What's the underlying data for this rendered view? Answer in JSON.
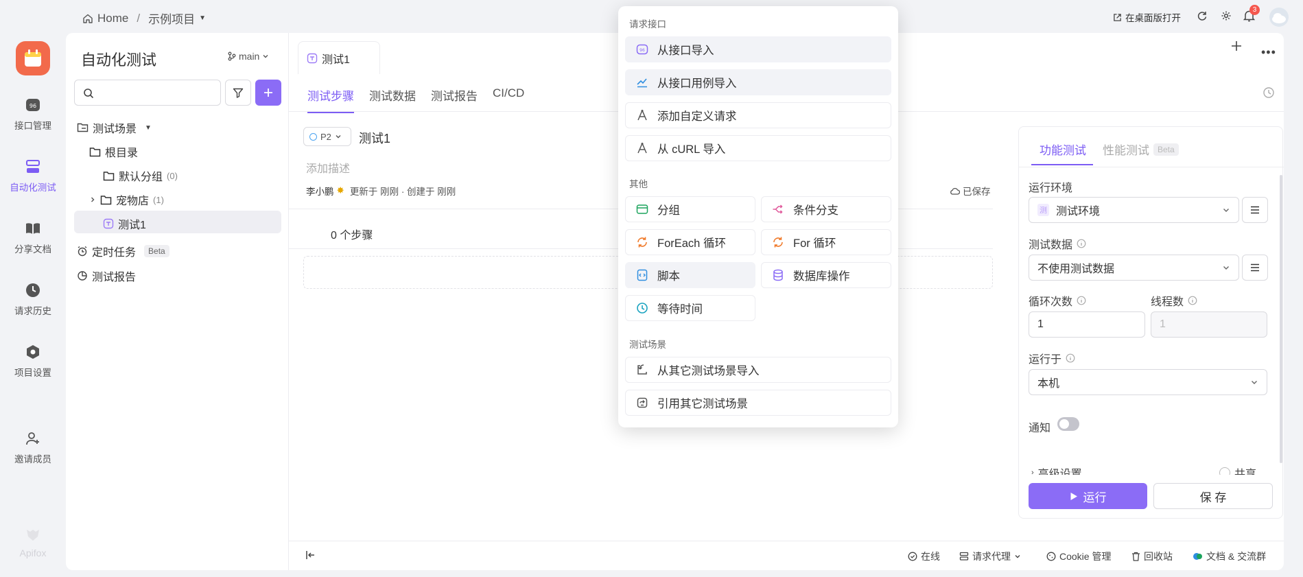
{
  "topbar": {
    "home": "Home",
    "separator": "/",
    "project": "示例项目",
    "open_desktop": "在桌面版打开",
    "notification_count": "3"
  },
  "rail": {
    "items": [
      {
        "label": "接口管理",
        "icon": "api-icon"
      },
      {
        "label": "自动化测试",
        "icon": "automation-icon"
      },
      {
        "label": "分享文档",
        "icon": "book-icon"
      },
      {
        "label": "请求历史",
        "icon": "clock-icon"
      },
      {
        "label": "项目设置",
        "icon": "settings-icon"
      }
    ],
    "invite": "邀请成员",
    "brand": "Apifox"
  },
  "tree": {
    "title": "自动化测试",
    "branch": "main",
    "nodes": {
      "scenarios": "测试场景",
      "root": "根目录",
      "default_group": "默认分组",
      "default_group_count": "(0)",
      "petstore": "宠物店",
      "petstore_count": "(1)",
      "test1": "测试1",
      "scheduled": "定时任务",
      "scheduled_badge": "Beta",
      "reports": "测试报告"
    }
  },
  "work": {
    "file_tab": "测试1",
    "subtabs": [
      "测试步骤",
      "测试数据",
      "测试报告",
      "CI/CD"
    ],
    "priority": "P2",
    "case_title": "测试1",
    "desc_placeholder": "添加描述",
    "author": "李小鹏",
    "meta": "更新于 刚刚 · 创建于 刚刚",
    "saved": "已保存",
    "steps_count": "0 个步骤"
  },
  "settings": {
    "tab_functional": "功能测试",
    "tab_performance": "性能测试",
    "performance_badge": "Beta",
    "env_label": "运行环境",
    "env_value": "测试环境",
    "env_badge": "测",
    "data_label": "测试数据",
    "data_value": "不使用测试数据",
    "loop_label": "循环次数",
    "loop_value": "1",
    "thread_label": "线程数",
    "thread_value": "1",
    "runon_label": "运行于",
    "runon_value": "本机",
    "notify_label": "通知",
    "notify_on": false,
    "advanced": "高级设置",
    "shared": "共享",
    "run": "运行",
    "save": "保 存"
  },
  "bottom": {
    "online": "在线",
    "proxy": "请求代理",
    "cookie": "Cookie 管理",
    "trash": "回收站",
    "community": "文档 & 交流群"
  },
  "menu": {
    "section_request": "请求接口",
    "request_items": [
      {
        "label": "从接口导入",
        "icon": "api-import-icon"
      },
      {
        "label": "从接口用例导入",
        "icon": "case-import-icon"
      },
      {
        "label": "添加自定义请求",
        "icon": "custom-request-icon"
      },
      {
        "label": "从 cURL 导入",
        "icon": "curl-icon"
      }
    ],
    "section_other": "其他",
    "other_items": [
      {
        "label": "分组",
        "icon": "group-icon"
      },
      {
        "label": "条件分支",
        "icon": "branch-icon"
      },
      {
        "label": "ForEach 循环",
        "icon": "loop-icon"
      },
      {
        "label": "For 循环",
        "icon": "loop-icon"
      },
      {
        "label": "脚本",
        "icon": "script-icon"
      },
      {
        "label": "数据库操作",
        "icon": "database-icon"
      },
      {
        "label": "等待时间",
        "icon": "wait-icon"
      }
    ],
    "section_scenario": "测试场景",
    "scenario_items": [
      {
        "label": "从其它测试场景导入",
        "icon": "scenario-import-icon"
      },
      {
        "label": "引用其它测试场景",
        "icon": "scenario-ref-icon"
      }
    ]
  },
  "colors": {
    "accent": "#8b6cf6",
    "logo": "#f26a4b",
    "orange": "#f07a2a",
    "blue": "#2f8ee0",
    "teal": "#1aa3c0"
  }
}
